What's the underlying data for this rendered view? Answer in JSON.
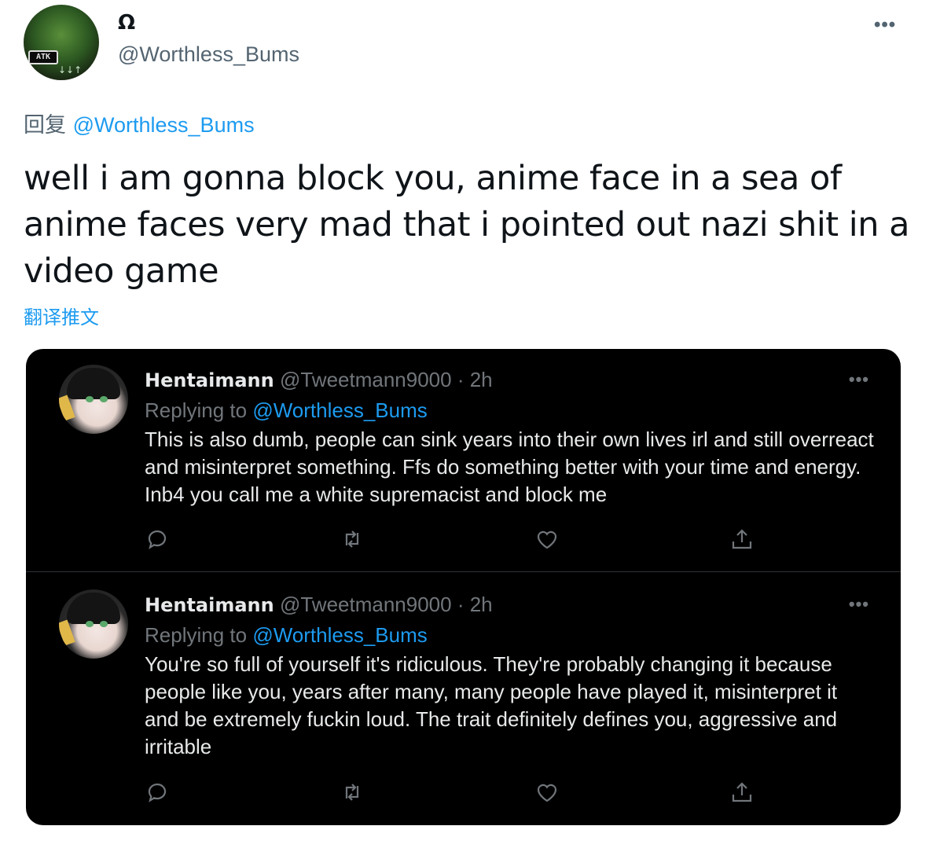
{
  "author": {
    "display_name": "Ω",
    "handle": "@Worthless_Bums",
    "avatar_badge": "ATK",
    "avatar_arrows": "↓↓↑"
  },
  "more_label": "•••",
  "reply_to": {
    "prefix": "回复",
    "mention": "@Worthless_Bums"
  },
  "tweet_text": "well i am gonna block you, anime face in a sea of anime faces very mad that i pointed out nazi shit in a video game",
  "translate_label": "翻译推文",
  "quoted_replies": [
    {
      "name": "Hentaimann",
      "meta": "@Tweetmann9000 · 2h",
      "replying_prefix": "Replying to",
      "replying_mention": "@Worthless_Bums",
      "body": "This is also dumb, people can sink years into their own lives irl and still overreact and misinterpret something. Ffs do something better with your time and energy. Inb4 you call me a white supremacist and block me",
      "more": "•••"
    },
    {
      "name": "Hentaimann",
      "meta": "@Tweetmann9000 · 2h",
      "replying_prefix": "Replying to",
      "replying_mention": "@Worthless_Bums",
      "body": "You're so full of yourself it's ridiculous. They're probably changing it because people like you, years after many, many people have played it, misinterpret it and be extremely fuckin loud. The trait definitely defines you, aggressive and irritable",
      "more": "•••"
    }
  ],
  "icons": [
    "reply-icon",
    "retweet-icon",
    "like-icon",
    "share-icon"
  ],
  "colors": {
    "accent": "#1d9bf0",
    "muted": "#536471",
    "dark_card": "#000000",
    "dark_text": "#e7e9ea",
    "dark_muted": "#71767b"
  }
}
